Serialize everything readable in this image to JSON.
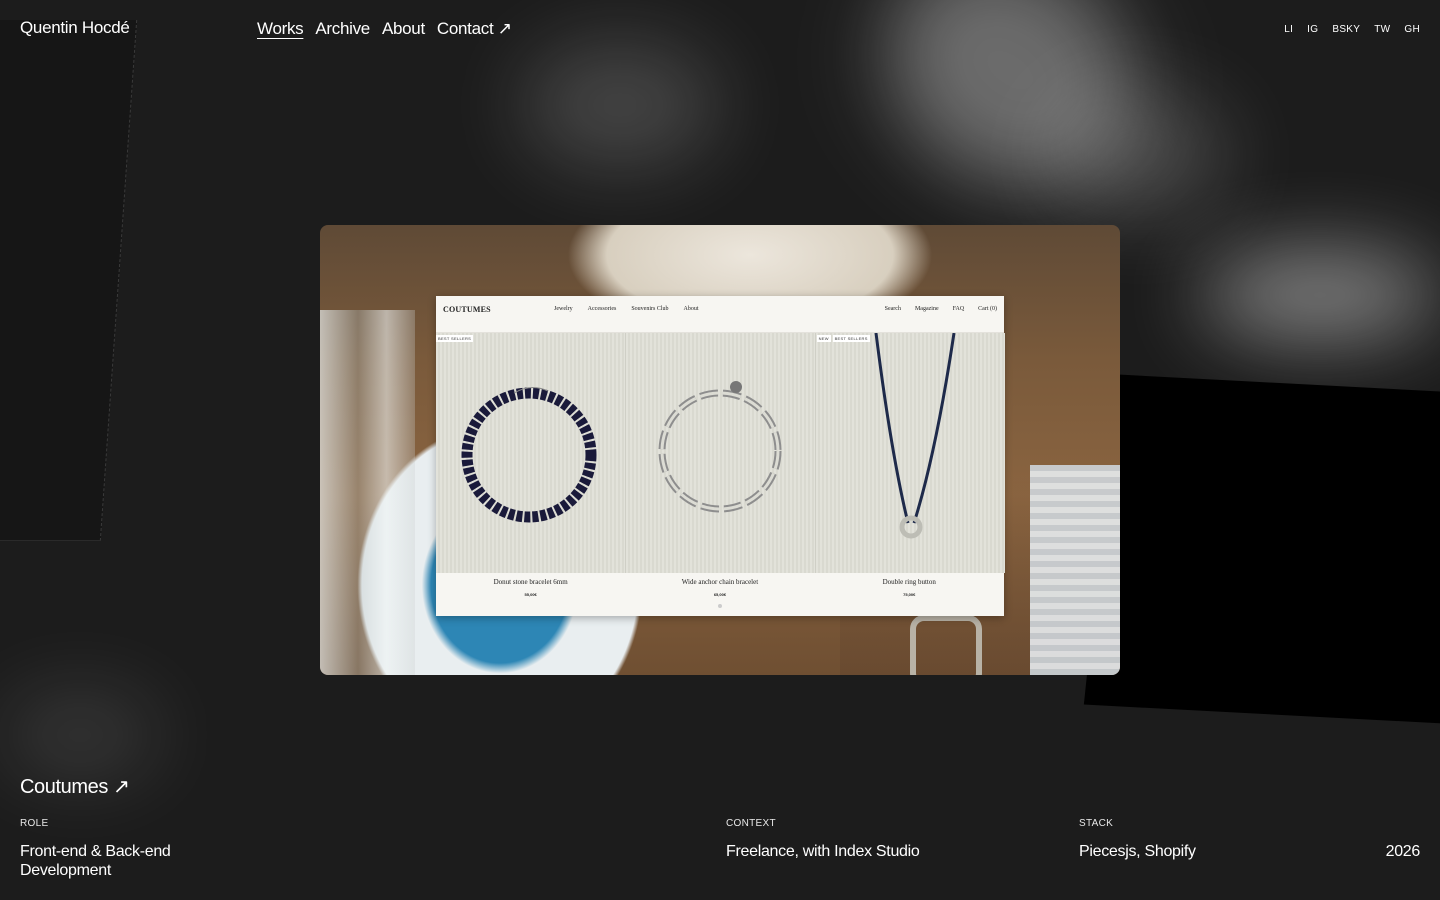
{
  "header": {
    "logo": "Quentin Hocdé",
    "nav": [
      {
        "label": "Works"
      },
      {
        "label": "Archive"
      },
      {
        "label": "About"
      },
      {
        "label": "Contact ↗"
      }
    ],
    "social": [
      "LI",
      "IG",
      "BSKY",
      "TW",
      "GH"
    ]
  },
  "preview_site": {
    "logo": "COUTUMES",
    "links": [
      "Jewelry",
      "Accessories",
      "Souvenirs Club",
      "About"
    ],
    "links_right": [
      "Search",
      "Magazine",
      "FAQ",
      "Cart (0)"
    ],
    "products": [
      {
        "badges": [
          "BEST SELLERS"
        ],
        "name": "Donut stone bracelet 6mm",
        "price": "55,00€"
      },
      {
        "badges": [],
        "name": "Wide anchor chain bracelet",
        "price": "65,00€"
      },
      {
        "badges": [
          "NEW",
          "BEST SELLERS"
        ],
        "name": "Double ring button",
        "price": "75,00€"
      }
    ]
  },
  "project": {
    "title": "Coutumes ↗",
    "role_label": "ROLE",
    "role_value_line1": "Front-end & Back-end",
    "role_value_line2": "Development",
    "context_label": "CONTEXT",
    "context_value": "Freelance, with Index Studio",
    "stack_label": "STACK",
    "stack_value": "Piecesjs, Shopify",
    "year": "2026"
  },
  "colors": {
    "background": "#1c1c1c",
    "text": "#ffffff"
  }
}
